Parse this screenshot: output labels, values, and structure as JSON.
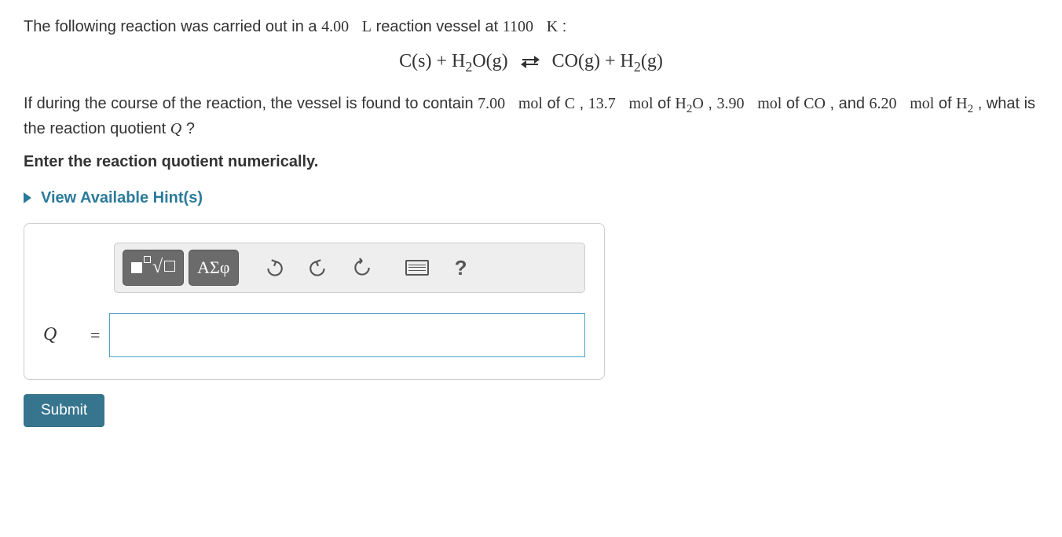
{
  "problem": {
    "intro_before_volume": "The following reaction was carried out in a ",
    "volume": "4.00",
    "volume_unit": "L",
    "intro_after_volume": " reaction vessel at ",
    "temperature": "1100",
    "temperature_unit": "K",
    "intro_end": ":",
    "equation": {
      "lhs1": "C(s)",
      "plus1": " + ",
      "lhs2_base": "H",
      "lhs2_sub": "2",
      "lhs2_tail": "O(g)",
      "rhs1": "CO(g)",
      "plus2": " + ",
      "rhs2_base": "H",
      "rhs2_sub": "2",
      "rhs2_tail": "(g)"
    },
    "body_prefix": "If during the course of the reaction, the vessel is found to contain ",
    "mol_C": "7.00",
    "unit_mol": "mol",
    "of": " of ",
    "sym_C": "C",
    "sep": ", ",
    "mol_H2O": "13.7",
    "sym_H2O_base": "H",
    "sym_H2O_sub": "2",
    "sym_H2O_tail": "O",
    "mol_CO": "3.90",
    "sym_CO": "CO",
    "and": "and ",
    "mol_H2": "6.20",
    "sym_H2_base": "H",
    "sym_H2_sub": "2",
    "body_suffix_a": ", what is the reaction quotient ",
    "Q_symbol": "Q",
    "body_suffix_b": "?"
  },
  "instruction": "Enter the reaction quotient numerically.",
  "hints_label": "View Available Hint(s)",
  "toolbar": {
    "greek_label": "ΑΣφ",
    "help_label": "?"
  },
  "answer": {
    "label": "Q",
    "equals": "=",
    "value": ""
  },
  "submit_label": "Submit"
}
